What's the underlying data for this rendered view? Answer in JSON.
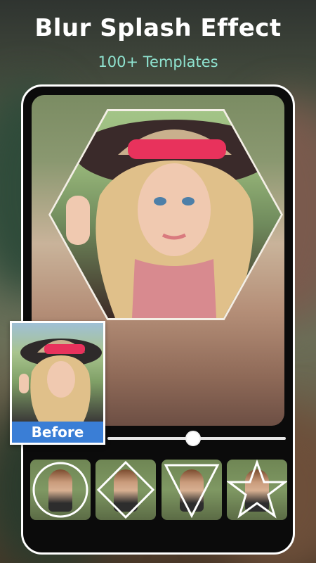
{
  "header": {
    "title": "Blur Splash Effect",
    "subtitle": "100+ Templates"
  },
  "editor": {
    "before_label": "Before",
    "blur_slider_value": 0.48,
    "colors": {
      "subtitle": "#8fe3d0",
      "before_badge": "#3a7ed6",
      "hat_band": "#e8325c"
    }
  },
  "templates": [
    {
      "shape": "circle-template"
    },
    {
      "shape": "diamond-template"
    },
    {
      "shape": "triangle-template"
    },
    {
      "shape": "star-template"
    }
  ]
}
